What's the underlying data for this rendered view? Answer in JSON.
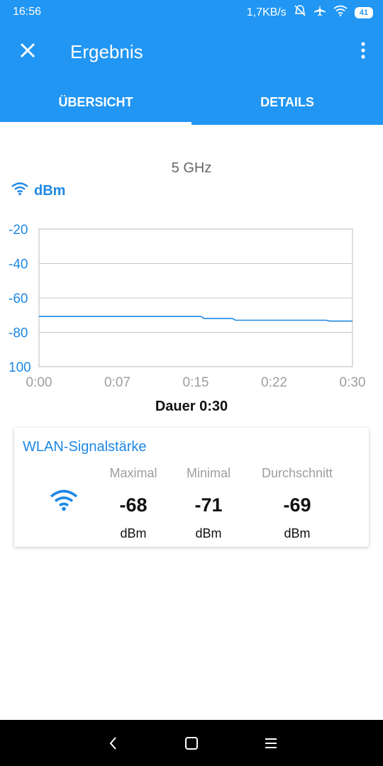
{
  "status_bar": {
    "time": "16:56",
    "speed": "1,7KB/s",
    "battery": "41",
    "icons": [
      "mute-icon",
      "airplane-icon",
      "wifi-icon",
      "battery-icon"
    ]
  },
  "app_bar": {
    "title": "Ergebnis",
    "close_icon": "close-icon",
    "menu_icon": "more-vert-icon"
  },
  "tabs": [
    {
      "label": "ÜBERSICHT",
      "active": true
    },
    {
      "label": "DETAILS",
      "active": false
    }
  ],
  "band": "5 GHz",
  "unit_label": "dBm",
  "chart_data": {
    "type": "line",
    "ylabel": "dBm",
    "xlabel": "Dauer 0:30",
    "y_ticks": [
      "-20",
      "-40",
      "-60",
      "-80",
      "100"
    ],
    "x_ticks": [
      "0:00",
      "0:07",
      "0:15",
      "0:22",
      "0:30"
    ],
    "ylim": [
      -20,
      -100
    ],
    "xlim": [
      0,
      30
    ],
    "series": [
      {
        "color": "#1e88e5",
        "x": [
          0,
          15.5,
          15.8,
          18.5,
          18.8,
          27.5,
          27.8,
          30
        ],
        "y": [
          -70.8,
          -70.8,
          -72,
          -72,
          -73,
          -73,
          -73.5,
          -73.5
        ]
      }
    ]
  },
  "duration_label": "Dauer 0:30",
  "signal_card": {
    "title": "WLAN-Signalstärke",
    "icon": "wifi-icon",
    "stats": [
      {
        "label": "Maximal",
        "value": "-68",
        "unit": "dBm"
      },
      {
        "label": "Minimal",
        "value": "-71",
        "unit": "dBm"
      },
      {
        "label": "Durchschnitt",
        "value": "-69",
        "unit": "dBm"
      }
    ]
  },
  "nav_bar": {
    "back_icon": "back-icon",
    "home_icon": "home-icon",
    "recents_icon": "menu-icon"
  },
  "colors": {
    "primary": "#2196f3",
    "accent": "#1e88e5"
  }
}
